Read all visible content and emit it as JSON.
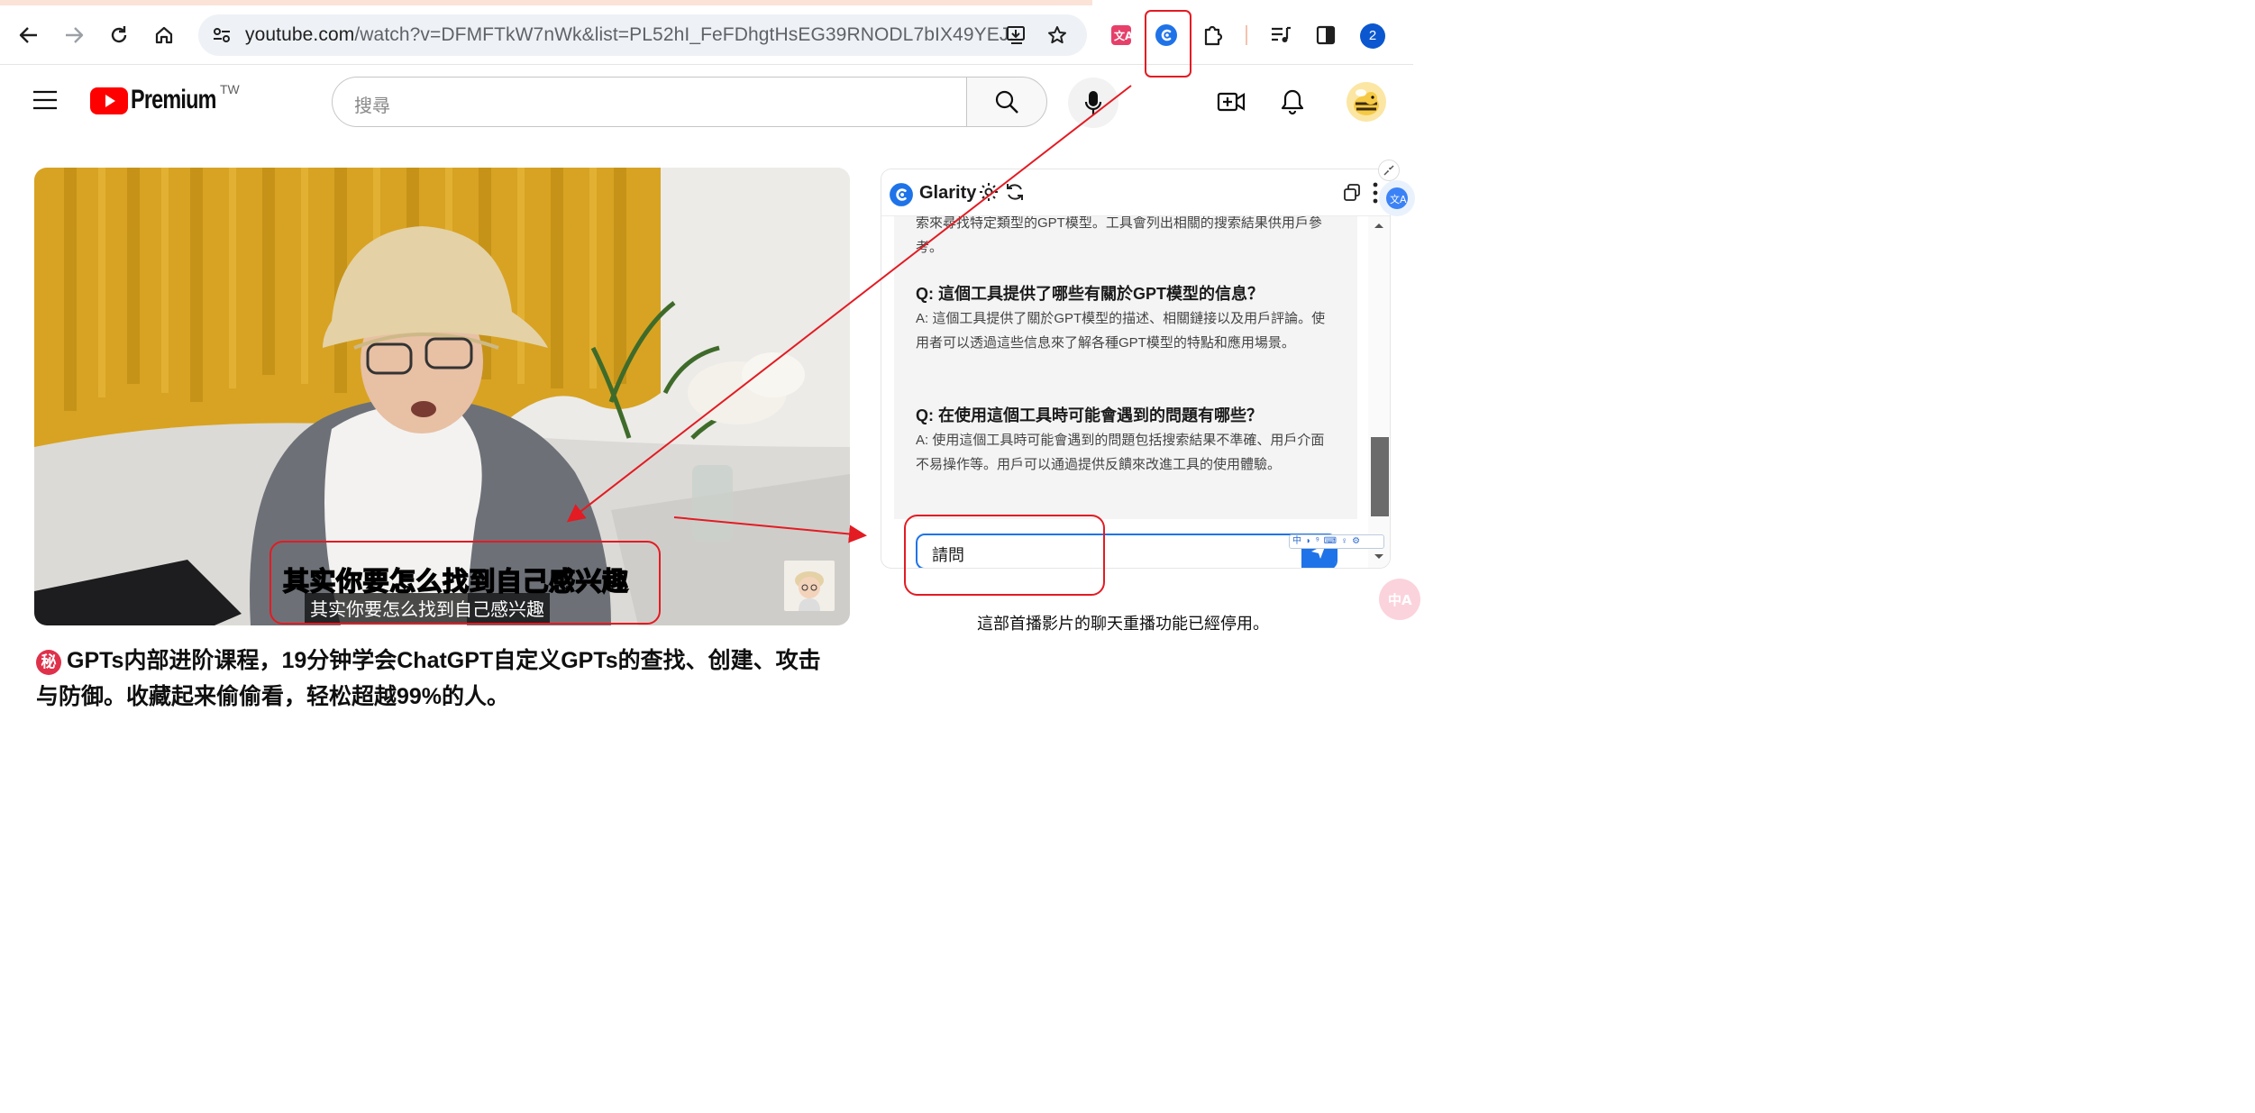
{
  "browser": {
    "url_host": "youtube.com",
    "url_rest": "/watch?v=DFMFTkW7nWk&list=PL52hI_FeFDhgtHsEG39RNODL7bIX49YEJ...",
    "profile_initial": "2",
    "icons": [
      "back-icon",
      "forward-icon",
      "reload-icon",
      "home-icon",
      "site-info-icon",
      "install-app-icon",
      "bookmark-star-icon",
      "translate-extension-icon",
      "glarity-extension-icon",
      "extensions-puzzle-icon",
      "media-controls-icon",
      "side-panel-icon"
    ]
  },
  "youtube": {
    "logo_text": "Premium",
    "region": "TW",
    "search_placeholder": "搜尋",
    "chat_disabled_notice": "這部首播影片的聊天重播功能已經停用。"
  },
  "video": {
    "caption_large": "其实你要怎么找到自己感兴趣",
    "caption_small": "其实你要怎么找到自己感兴趣",
    "title_badge": "秘",
    "title": "GPTs内部进阶课程，19分钟学会ChatGPT自定义GPTs的查找、创建、攻击与防御。收藏起来偷偷看，轻松超越99%的人。"
  },
  "glarity": {
    "title": "Glarity",
    "partial_answer": "索來尋找特定類型的GPT模型。工具會列出相關的搜索結果供用戶參考。",
    "qa": [
      {
        "q": "Q: 這個工具提供了哪些有關於GPT模型的信息？",
        "a": "A: 這個工具提供了關於GPT模型的描述、相關鏈接以及用戶評論。使用者可以透過這些信息來了解各種GPT模型的特點和應用場景。"
      },
      {
        "q": "Q: 在使用這個工具時可能會遇到的問題有哪些？",
        "a": "A: 使用這個工具時可能會遇到的問題包括搜索結果不準確、用戶介面不易操作等。用戶可以通過提供反饋來改進工具的使用體驗。"
      }
    ],
    "input_value": "請問",
    "ime_toolbar": "中 ◗ ⁹ ⌨ ♀ ⚙"
  },
  "colors": {
    "youtube_red": "#ff0000",
    "glarity_blue": "#1f73e8",
    "annotation_red": "#e31b23",
    "profile_blue": "#0b57d0"
  }
}
